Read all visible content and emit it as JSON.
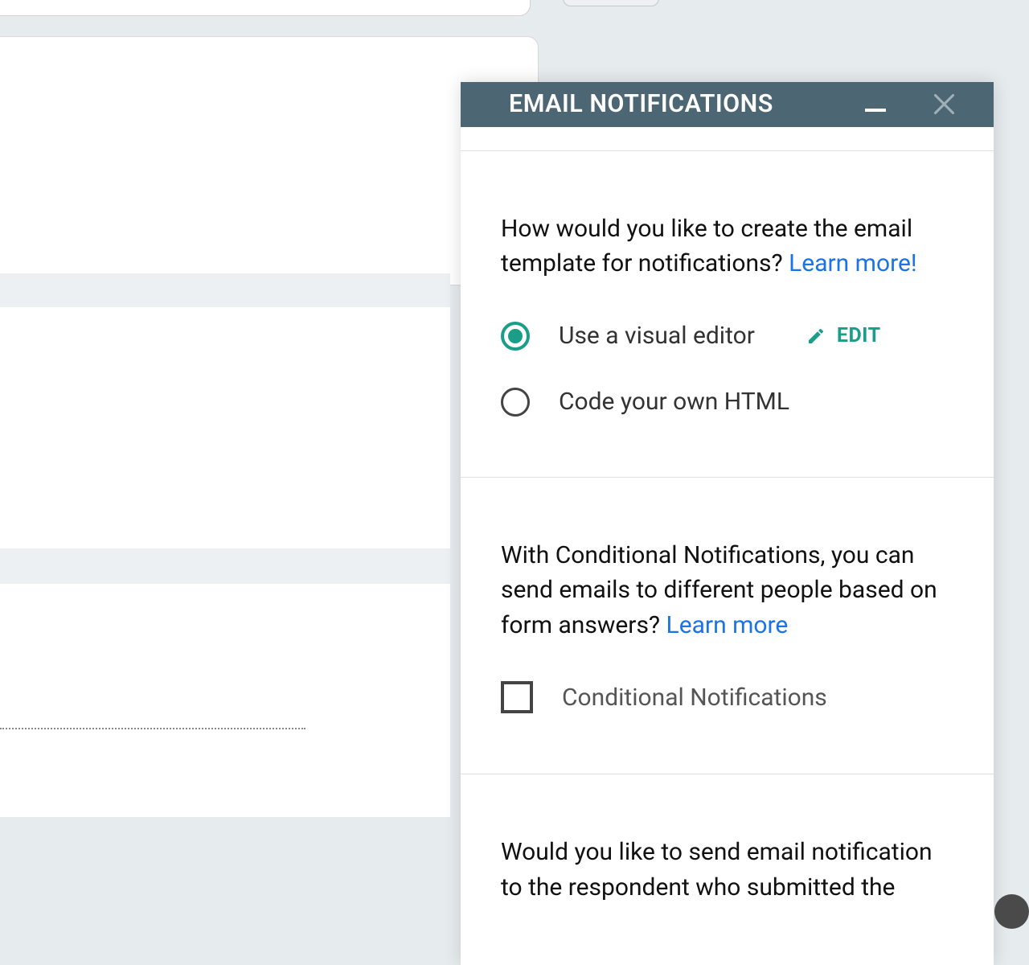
{
  "panel": {
    "title": "EMAIL NOTIFICATIONS"
  },
  "section_template": {
    "prompt": "How would you like to create the email template for notifications? ",
    "learn_more": "Learn more!",
    "option_visual": "Use a visual editor",
    "edit_label": "EDIT",
    "option_html": "Code your own HTML"
  },
  "section_conditional": {
    "prompt": "With Conditional Notifications, you can send emails to different people based on form answers? ",
    "learn_more": "Learn more",
    "checkbox_label": "Conditional Notifications"
  },
  "section_respondent": {
    "prompt": "Would you like to send email notification to the respondent who submitted the"
  }
}
